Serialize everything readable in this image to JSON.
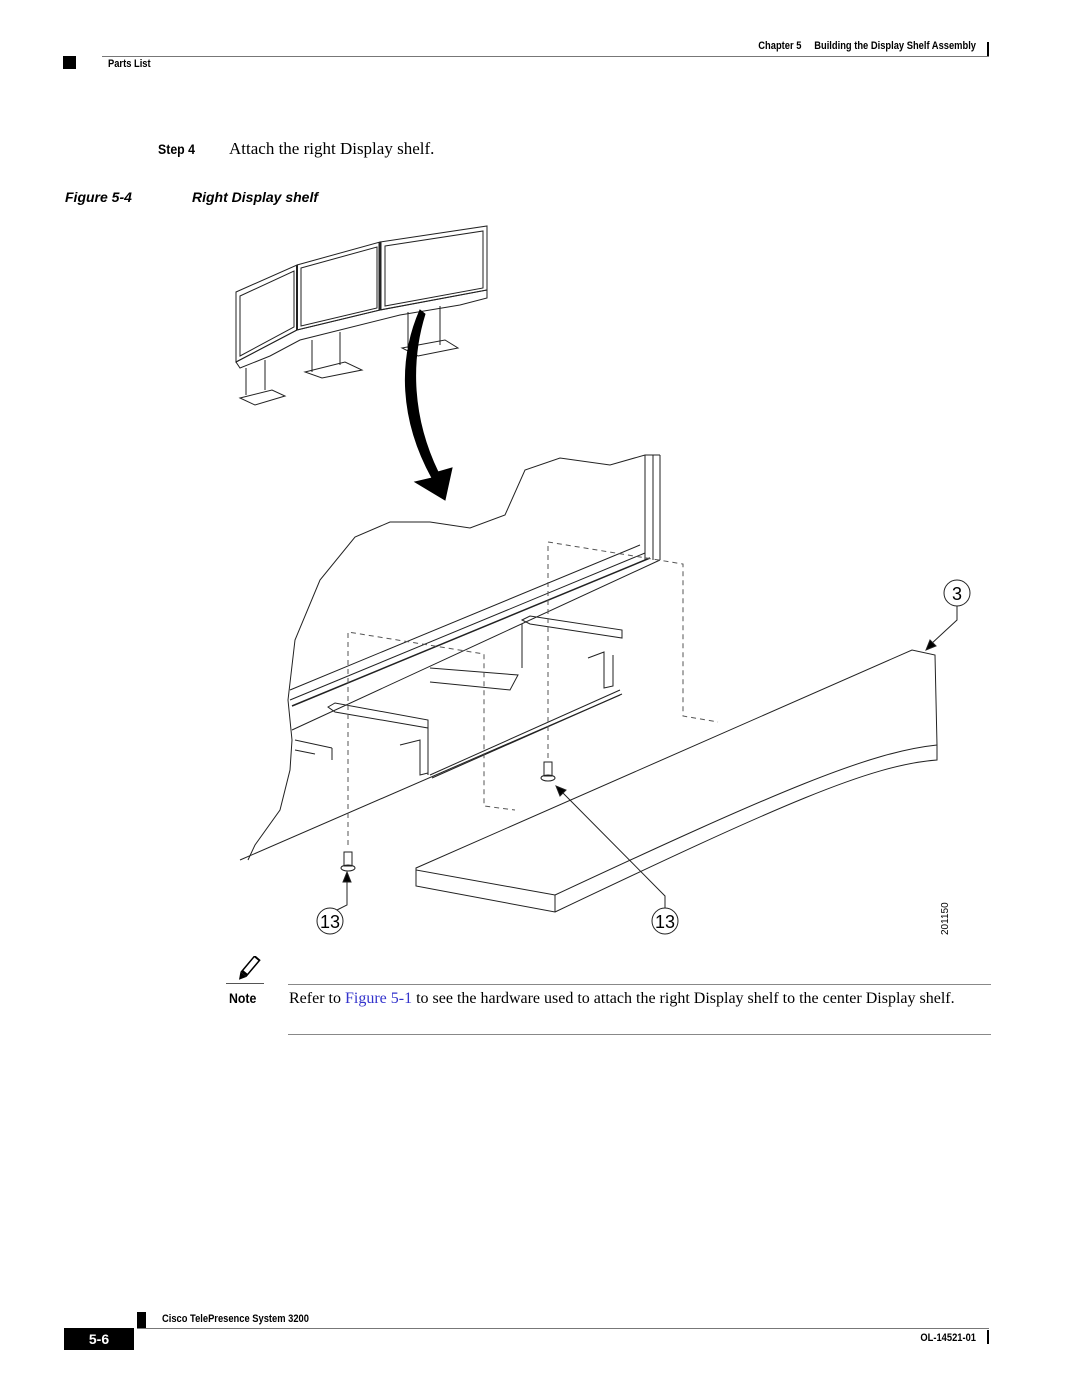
{
  "header": {
    "chapter_label": "Chapter 5",
    "chapter_title": "Building the Display Shelf Assembly",
    "section": "Parts List"
  },
  "step": {
    "label": "Step 4",
    "text": "Attach the right Display shelf."
  },
  "figure": {
    "label": "Figure 5-4",
    "title": "Right Display shelf",
    "callouts": [
      "13",
      "13",
      "3"
    ],
    "art_id": "201150"
  },
  "note": {
    "icon": "pencil-note-icon",
    "label": "Note",
    "text_before": "Refer to ",
    "link_text": "Figure 5-1",
    "text_after": " to see the hardware used to attach the right Display shelf to the center Display shelf.",
    "link_color": "#3333cc"
  },
  "footer": {
    "book_title": "Cisco TelePresence System 3200",
    "page_number": "5-6",
    "doc_number": "OL-14521-01"
  }
}
